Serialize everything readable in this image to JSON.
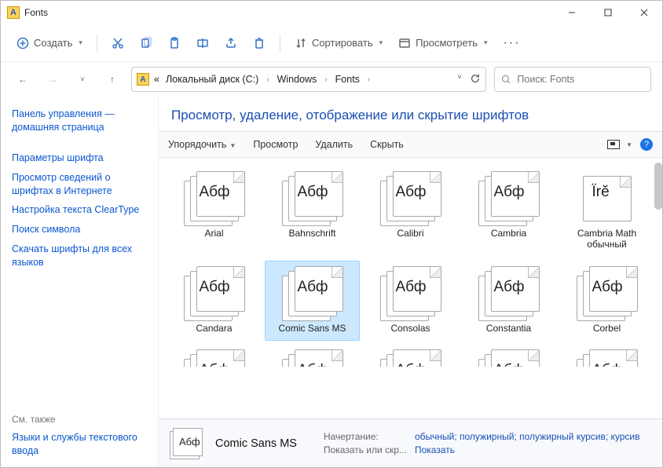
{
  "window": {
    "title": "Fonts"
  },
  "toolbar": {
    "create": "Создать",
    "sort": "Сортировать",
    "view": "Просмотреть"
  },
  "breadcrumb": {
    "prefix": "«",
    "items": [
      "Локальный диск (C:)",
      "Windows",
      "Fonts"
    ]
  },
  "search": {
    "placeholder": "Поиск: Fonts"
  },
  "sidebar": {
    "home": "Панель управления — домашняя страница",
    "links": [
      "Параметры шрифта",
      "Просмотр сведений о шрифтах в Интернете",
      "Настройка текста ClearType",
      "Поиск символа",
      "Скачать шрифты для всех языков"
    ],
    "seealso_label": "См. также",
    "seealso": "Языки и службы текстового ввода"
  },
  "content": {
    "heading": "Просмотр, удаление, отображение или скрытие шрифтов",
    "cmd": {
      "organize": "Упорядочить",
      "preview": "Просмотр",
      "delete": "Удалить",
      "hide": "Скрыть"
    }
  },
  "fonts": [
    {
      "label": "Arial",
      "sample": "Абф",
      "stack": true
    },
    {
      "label": "Bahnschrift",
      "sample": "Абф",
      "stack": true
    },
    {
      "label": "Calibri",
      "sample": "Абф",
      "stack": true
    },
    {
      "label": "Cambria",
      "sample": "Абф",
      "stack": true
    },
    {
      "label": "Cambria Math обычный",
      "sample": "Ïrĕ",
      "stack": false
    },
    {
      "label": "Candara",
      "sample": "Абф",
      "stack": true
    },
    {
      "label": "Comic Sans MS",
      "sample": "Абф",
      "stack": true,
      "selected": true
    },
    {
      "label": "Consolas",
      "sample": "Абф",
      "stack": true
    },
    {
      "label": "Constantia",
      "sample": "Абф",
      "stack": true
    },
    {
      "label": "Corbel",
      "sample": "Абф",
      "stack": true
    }
  ],
  "partial_sample": "Абф",
  "details": {
    "name": "Comic Sans MS",
    "rows": [
      {
        "k": "Начертание:",
        "v": "обычный; полужирный; полужирный курсив; курсив"
      },
      {
        "k": "Показать или скр...",
        "v": "Показать"
      }
    ]
  }
}
